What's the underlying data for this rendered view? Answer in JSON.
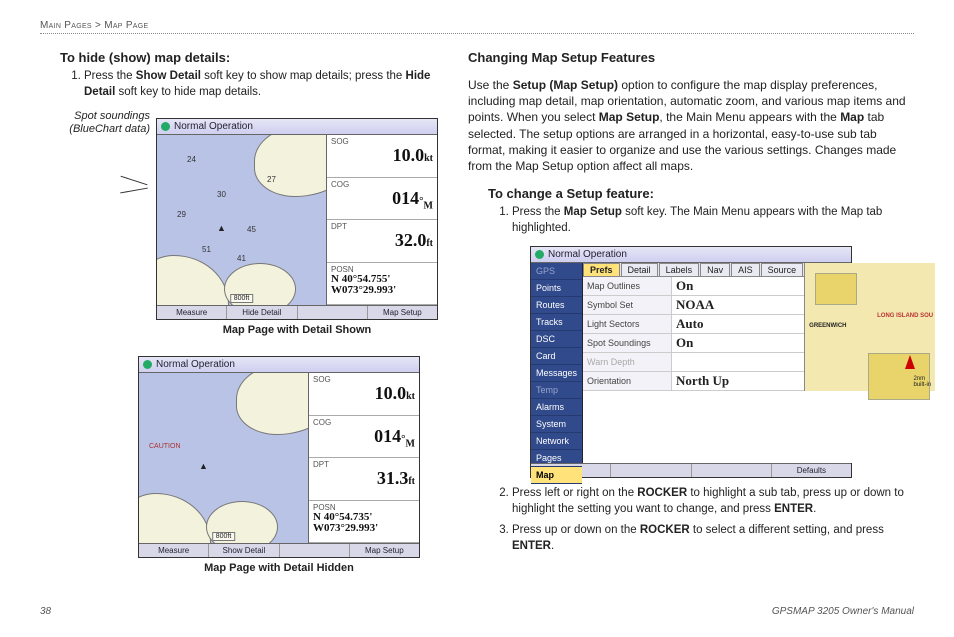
{
  "breadcrumb": "Main Pages > Map Page",
  "left": {
    "heading": "To hide (show) map details:",
    "step1_pre": "Press the ",
    "show_detail": "Show Detail",
    "step1_mid": " soft key to show map details; press the ",
    "hide_detail": "Hide Detail",
    "step1_post": " soft key to hide map details.",
    "side_label_l1": "Spot soundings",
    "side_label_l2": "(BlueChart data)",
    "fig1": {
      "header": "Normal Operation",
      "sog_lbl": "SOG",
      "sog_val": "10.0",
      "sog_unit": "kt",
      "cog_lbl": "COG",
      "cog_val": "014",
      "cog_deg": "°",
      "cog_unit": "M",
      "dpt_lbl": "DPT",
      "dpt_val": "32.0",
      "dpt_unit": "ft",
      "posn_lbl": "POSN",
      "posn_lat": "N 40°54.755'",
      "posn_lon": "W073°29.993'",
      "sk1": "Measure",
      "sk2": "Hide Detail",
      "sk3": "",
      "sk4": "Map Setup",
      "caption": "Map Page with Detail Shown"
    },
    "fig2": {
      "header": "Normal Operation",
      "sog_lbl": "SOG",
      "sog_val": "10.0",
      "sog_unit": "kt",
      "cog_lbl": "COG",
      "cog_val": "014",
      "cog_deg": "°",
      "cog_unit": "M",
      "dpt_lbl": "DPT",
      "dpt_val": "31.3",
      "dpt_unit": "ft",
      "posn_lbl": "POSN",
      "posn_lat": "N 40°54.735'",
      "posn_lon": "W073°29.993'",
      "sk1": "Measure",
      "sk2": "Show Detail",
      "sk3": "",
      "sk4": "Map Setup",
      "caption": "Map Page with Detail Hidden"
    }
  },
  "right": {
    "heading": "Changing Map Setup Features",
    "para_a": "Use the ",
    "setup_bold": "Setup (Map Setup)",
    "para_b": " option to configure the map display preferences, including map detail, map orientation, automatic zoom, and various map items and points. When you select ",
    "map_setup_bold": "Map Setup",
    "para_c": ", the Main Menu appears with the ",
    "map_bold": "Map",
    "para_d": " tab selected. The setup options are arranged in a horizontal, easy-to-use sub tab format, making it easier to organize and use the various settings. Changes made from the Map Setup option affect all maps.",
    "subheading": "To change a Setup feature:",
    "s1_a": "Press the ",
    "s1_b": "Map Setup",
    "s1_c": " soft key. The Main Menu appears with the Map tab highlighted.",
    "s2_a": "Press left or right on the ",
    "rocker": "ROCKER",
    "s2_b": " to highlight a sub tab, press up or down to highlight the setting you want to change, and press ",
    "enter": "ENTER",
    "s2_c": ".",
    "s3_a": "Press up or down on the ",
    "s3_b": " to select a different setting, and press ",
    "setup_fig": {
      "header": "Normal Operation",
      "tabs": [
        "Prefs",
        "Detail",
        "Labels",
        "Nav",
        "AIS",
        "Source"
      ],
      "tab_selected": "Prefs",
      "side": [
        "GPS",
        "Points",
        "Routes",
        "Tracks",
        "DSC",
        "Card",
        "Messages",
        "Temp",
        "Alarms",
        "System",
        "Network",
        "Pages",
        "Map"
      ],
      "rows": [
        {
          "k": "Map Outlines",
          "v": "On"
        },
        {
          "k": "Symbol Set",
          "v": "NOAA"
        },
        {
          "k": "Light Sectors",
          "v": "Auto"
        },
        {
          "k": "Spot Soundings",
          "v": "On"
        },
        {
          "k": "Warn Depth",
          "v": "",
          "dim": true
        },
        {
          "k": "Orientation",
          "v": "North Up"
        }
      ],
      "defaults": "Defaults",
      "preview_label1": "GREENWICH",
      "preview_label2": "LONG ISLAND SOU"
    }
  },
  "footer": {
    "page": "38",
    "manual": "GPSMAP 3205 Owner's Manual"
  }
}
